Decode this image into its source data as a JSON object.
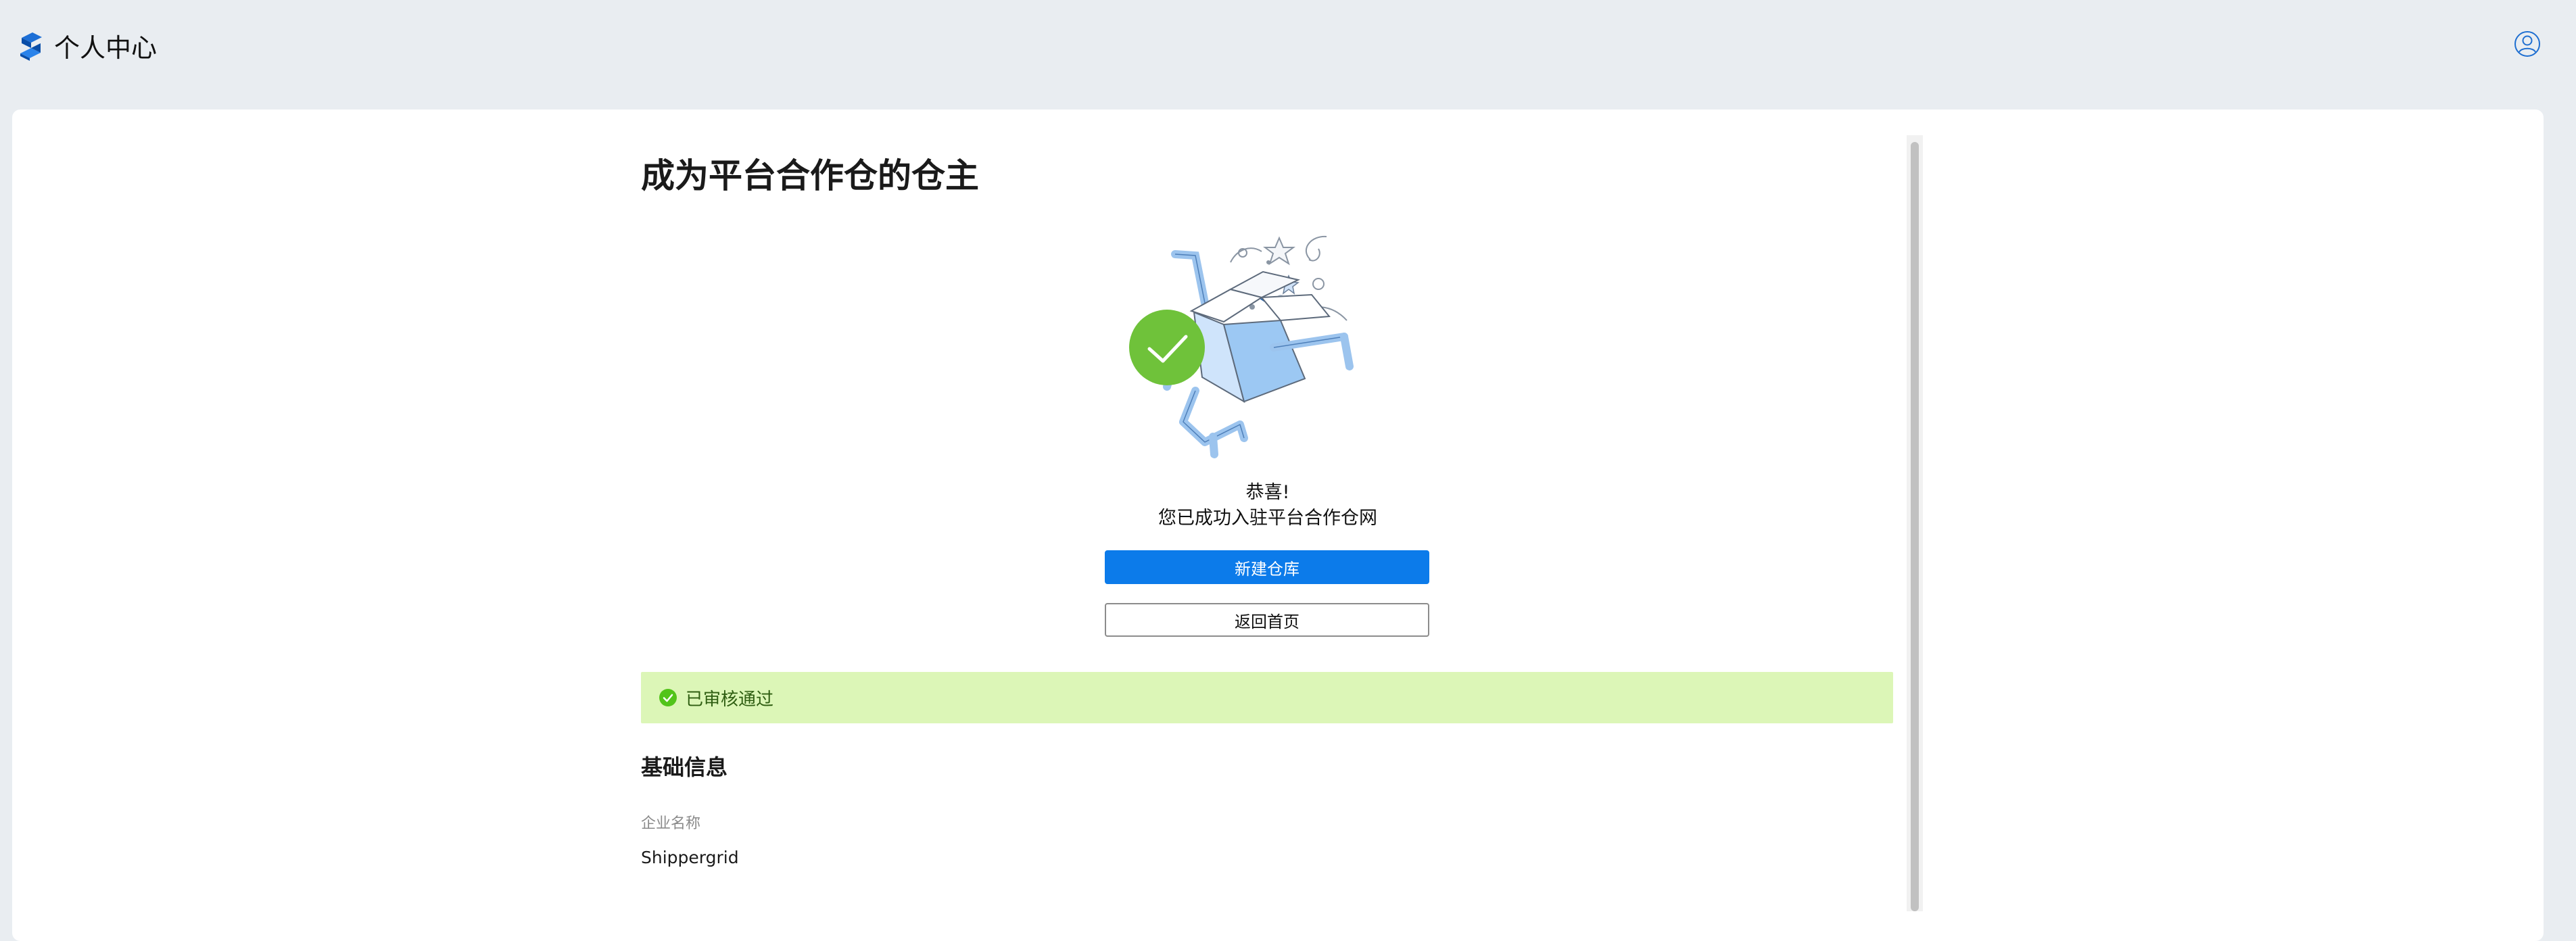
{
  "header": {
    "title": "个人中心",
    "logo_icon": "brand-s-logo",
    "user_icon": "user-avatar-icon"
  },
  "page": {
    "title": "成为平台合作仓的仓主"
  },
  "success": {
    "illustration": "open-box-success-illustration",
    "line1": "恭喜!",
    "line2": "您已成功入驻平台合作仓网"
  },
  "actions": {
    "create_warehouse": "新建仓库",
    "back_home": "返回首页"
  },
  "status": {
    "icon": "check-circle-icon",
    "text": "已审核通过",
    "color": "#dcf6b7",
    "accent": "#52c41a"
  },
  "basic_info": {
    "section_title": "基础信息",
    "company_name_label": "企业名称",
    "company_name_value": "Shippergrid"
  },
  "colors": {
    "primary": "#0c7bea",
    "background": "#e9edf1",
    "success_green": "#6fc23a"
  }
}
